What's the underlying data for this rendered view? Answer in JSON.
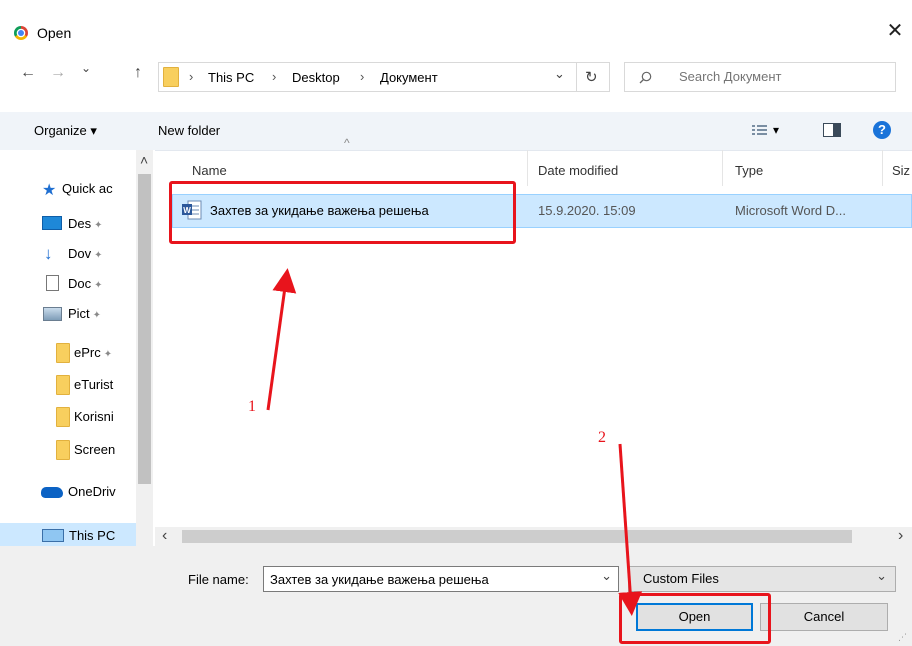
{
  "window": {
    "title": "Open",
    "close_glyph": "✕"
  },
  "address": {
    "back_glyph": "←",
    "forward_glyph": "→",
    "recent_glyph": "⌄",
    "up_glyph": "↑",
    "breadcrumb": [
      "This PC",
      "Desktop",
      "Документ"
    ],
    "separator": "›",
    "dropdown_glyph": "⌄",
    "refresh_glyph": "↻"
  },
  "search": {
    "placeholder": "Search Документ"
  },
  "toolbar": {
    "organize": "Organize ▾",
    "new_folder": "New folder",
    "view_dropdown": "▾",
    "help": "?"
  },
  "navpane": {
    "items": [
      {
        "label": "Quick ac",
        "icon": "star-icon"
      },
      {
        "label": "Des",
        "icon": "desktop-icon",
        "pinned": true
      },
      {
        "label": "Dov",
        "icon": "download-icon",
        "pinned": true
      },
      {
        "label": "Doc",
        "icon": "documents-icon",
        "pinned": true
      },
      {
        "label": "Pict",
        "icon": "pictures-icon",
        "pinned": true
      },
      {
        "label": "ePrc",
        "icon": "folder-icon",
        "pinned": true
      },
      {
        "label": "eTurist",
        "icon": "folder-icon"
      },
      {
        "label": "Korisni",
        "icon": "folder-icon"
      },
      {
        "label": "Screen",
        "icon": "folder-icon"
      },
      {
        "label": "OneDriv",
        "icon": "onedrive-icon"
      },
      {
        "label": "This PC",
        "icon": "this-pc-icon"
      }
    ],
    "pin_glyph": "✦",
    "scroll_up": "˄",
    "scroll_down": "˅"
  },
  "filelist": {
    "columns": [
      "Name",
      "Date modified",
      "Type",
      "Siz"
    ],
    "sort_glyph": "^",
    "rows": [
      {
        "name": "Захтев за укидање важења решења",
        "date": "15.9.2020. 15:09",
        "type": "Microsoft Word D..."
      }
    ],
    "hscroll_left": "‹",
    "hscroll_right": "›"
  },
  "bottom": {
    "filename_label": "File name:",
    "filename_value": "Захтев за укидање важења решења",
    "filter_value": "Custom Files",
    "dropdown_glyph": "⌄",
    "open": "Open",
    "cancel": "Cancel"
  },
  "annotations": {
    "step1": "1",
    "step2": "2"
  },
  "colors": {
    "accent": "#0078d7",
    "selection": "#cce8ff",
    "annotation": "#e8141c"
  }
}
